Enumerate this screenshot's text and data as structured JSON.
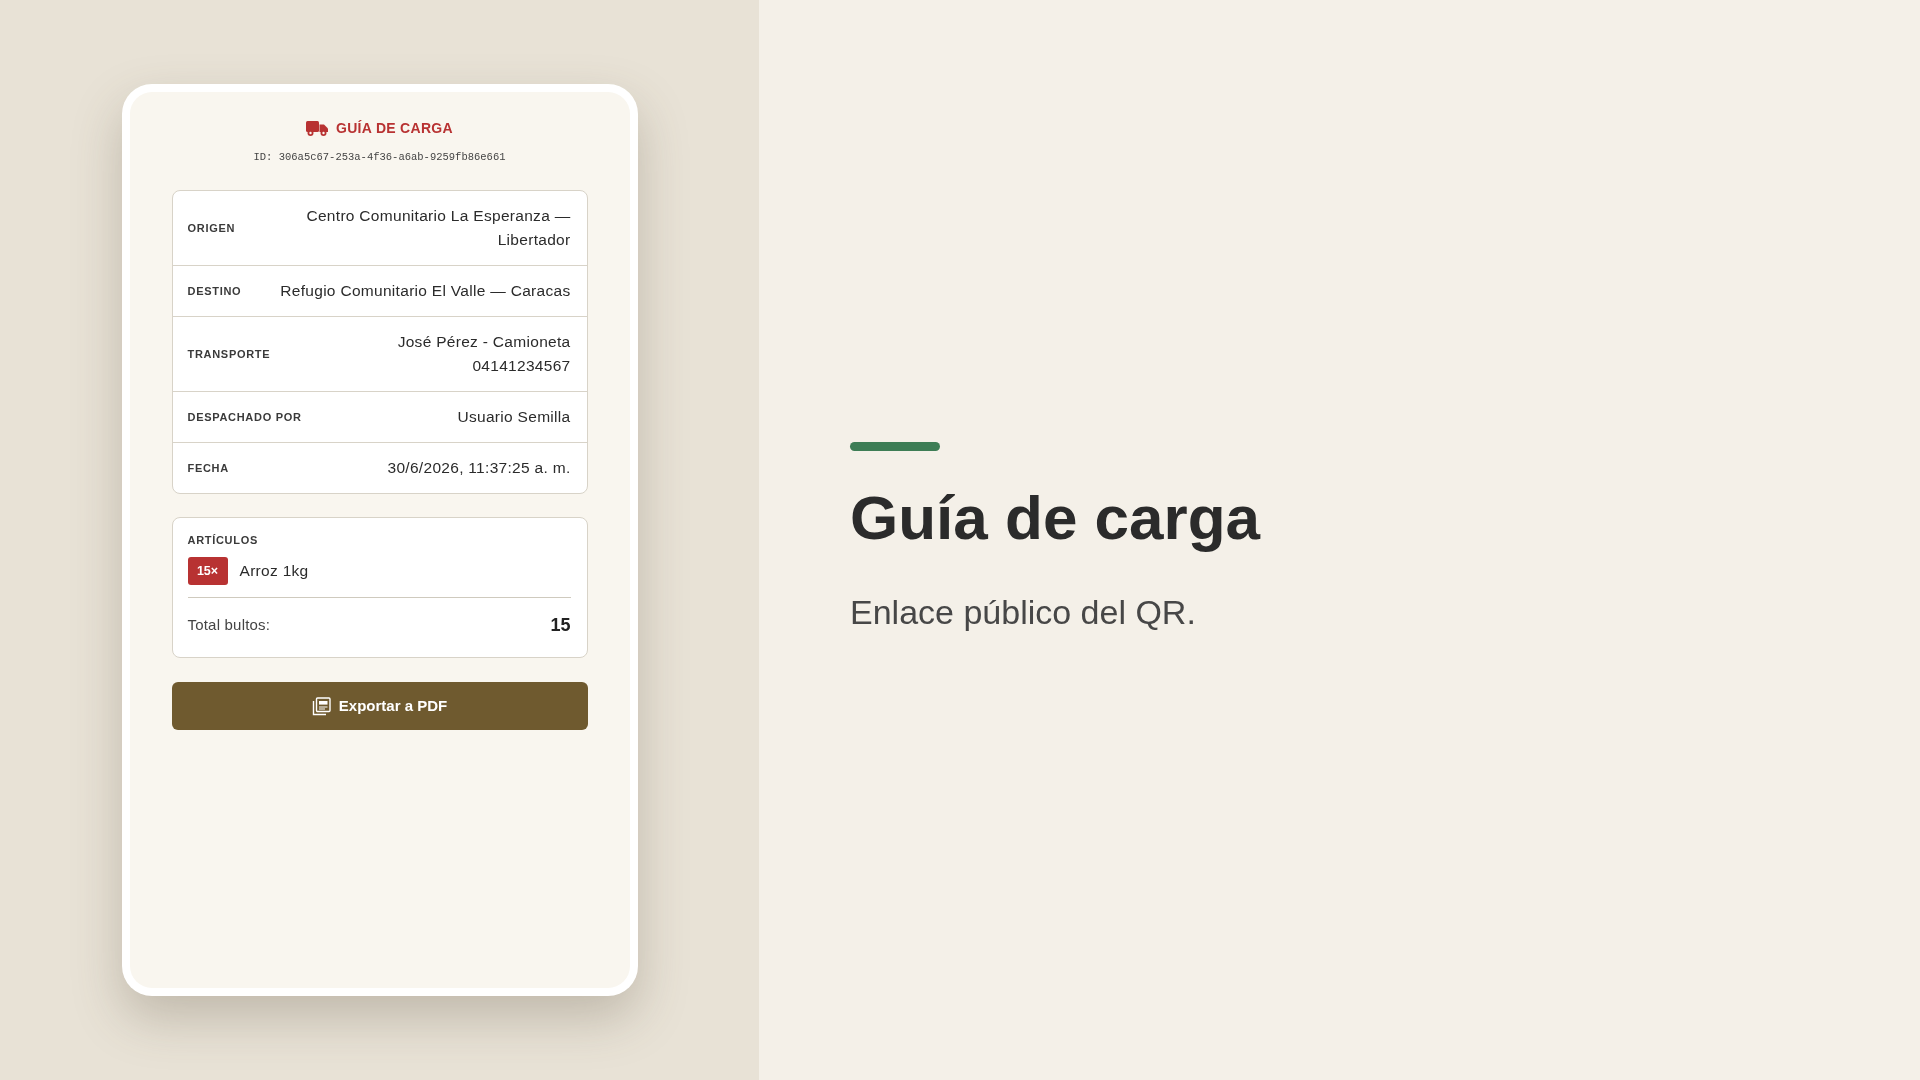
{
  "header": {
    "title": "GUÍA DE CARGA",
    "id_line": "ID: 306a5c67-253a-4f36-a6ab-9259fb86e661"
  },
  "details": [
    {
      "label": "ORIGEN",
      "value": "Centro Comunitario La Esperanza — Libertador"
    },
    {
      "label": "DESTINO",
      "value": "Refugio Comunitario El Valle — Caracas"
    },
    {
      "label": "TRANSPORTE",
      "value": "José Pérez - Camioneta 04141234567"
    },
    {
      "label": "DESPACHADO POR",
      "value": "Usuario Semilla"
    },
    {
      "label": "FECHA",
      "value": "30/6/2026, 11:37:25 a. m."
    }
  ],
  "articles": {
    "heading": "ARTÍCULOS",
    "items": [
      {
        "quantity": "15×",
        "name": "Arroz 1kg"
      }
    ],
    "total_label": "Total bultos:",
    "total_value": "15"
  },
  "export_button": {
    "label": "Exportar a PDF"
  },
  "hero": {
    "title": "Guía de carga",
    "subtitle": "Enlace público del QR."
  }
}
